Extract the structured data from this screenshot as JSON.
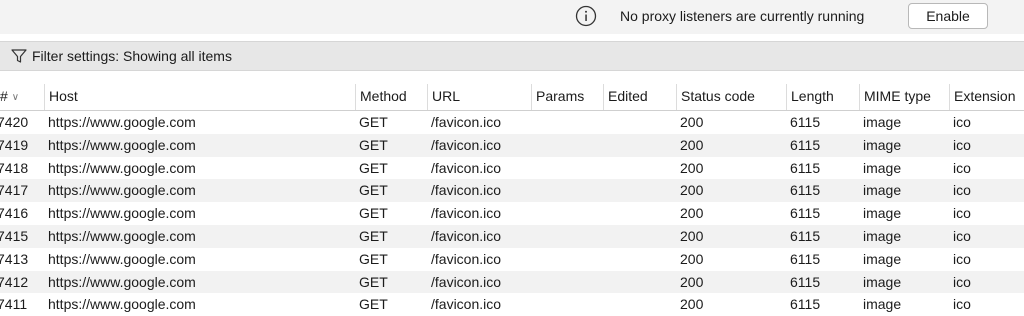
{
  "topbar": {
    "message": "No proxy listeners are currently running",
    "enable_label": "Enable",
    "info_icon": "info-circle-icon"
  },
  "filter": {
    "icon": "funnel-icon",
    "label": "Filter settings: Showing all items"
  },
  "table": {
    "columns": [
      "#",
      "Host",
      "Method",
      "URL",
      "Params",
      "Edited",
      "Status code",
      "Length",
      "MIME type",
      "Extension"
    ],
    "sort_icon": "chevron-down-icon",
    "rows": [
      {
        "num": "7420",
        "host": "https://www.google.com",
        "method": "GET",
        "url": "/favicon.ico",
        "params": "",
        "edited": "",
        "status": "200",
        "length": "6115",
        "mime": "image",
        "ext": "ico"
      },
      {
        "num": "7419",
        "host": "https://www.google.com",
        "method": "GET",
        "url": "/favicon.ico",
        "params": "",
        "edited": "",
        "status": "200",
        "length": "6115",
        "mime": "image",
        "ext": "ico"
      },
      {
        "num": "7418",
        "host": "https://www.google.com",
        "method": "GET",
        "url": "/favicon.ico",
        "params": "",
        "edited": "",
        "status": "200",
        "length": "6115",
        "mime": "image",
        "ext": "ico"
      },
      {
        "num": "7417",
        "host": "https://www.google.com",
        "method": "GET",
        "url": "/favicon.ico",
        "params": "",
        "edited": "",
        "status": "200",
        "length": "6115",
        "mime": "image",
        "ext": "ico"
      },
      {
        "num": "7416",
        "host": "https://www.google.com",
        "method": "GET",
        "url": "/favicon.ico",
        "params": "",
        "edited": "",
        "status": "200",
        "length": "6115",
        "mime": "image",
        "ext": "ico"
      },
      {
        "num": "7415",
        "host": "https://www.google.com",
        "method": "GET",
        "url": "/favicon.ico",
        "params": "",
        "edited": "",
        "status": "200",
        "length": "6115",
        "mime": "image",
        "ext": "ico"
      },
      {
        "num": "7413",
        "host": "https://www.google.com",
        "method": "GET",
        "url": "/favicon.ico",
        "params": "",
        "edited": "",
        "status": "200",
        "length": "6115",
        "mime": "image",
        "ext": "ico"
      },
      {
        "num": "7412",
        "host": "https://www.google.com",
        "method": "GET",
        "url": "/favicon.ico",
        "params": "",
        "edited": "",
        "status": "200",
        "length": "6115",
        "mime": "image",
        "ext": "ico"
      },
      {
        "num": "7411",
        "host": "https://www.google.com",
        "method": "GET",
        "url": "/favicon.ico",
        "params": "",
        "edited": "",
        "status": "200",
        "length": "6115",
        "mime": "image",
        "ext": "ico"
      }
    ]
  }
}
